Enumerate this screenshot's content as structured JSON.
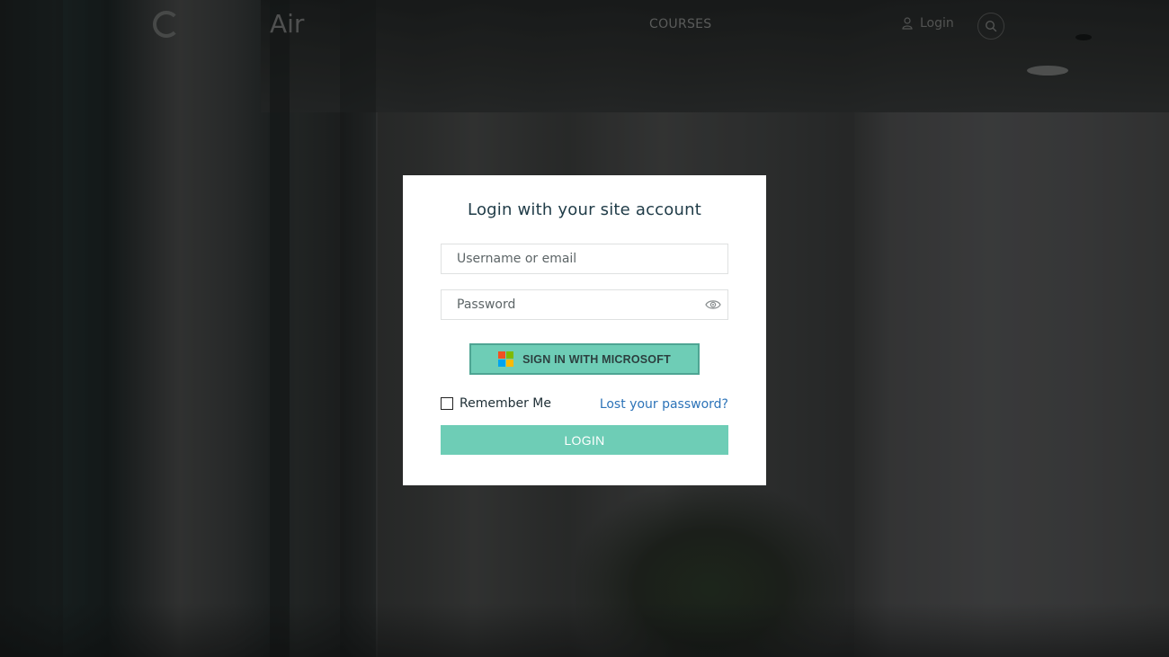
{
  "site_header": {
    "logo_text": "Air",
    "nav_courses": "COURSES",
    "login_label": "Login"
  },
  "modal": {
    "title": "Login with your site account",
    "username_placeholder": "Username or email",
    "password_placeholder": "Password",
    "microsoft_button_label": "SIGN IN WITH MICROSOFT",
    "remember_me_label": "Remember Me",
    "remember_me_checked": false,
    "lost_password_link": "Lost your password?",
    "login_button_label": "LOGIN"
  },
  "colors": {
    "accent": "#6ecdb6",
    "accent_border": "#4ea593",
    "link": "#2c73b8",
    "title_text": "#1f3b47",
    "microsoft_logo": [
      "#f25022",
      "#7fba00",
      "#00a4ef",
      "#ffb900"
    ]
  },
  "icons": {
    "password_toggle": "eye-icon",
    "header_user": "user-icon",
    "header_search": "search-icon",
    "microsoft": "microsoft-logo-icon"
  }
}
